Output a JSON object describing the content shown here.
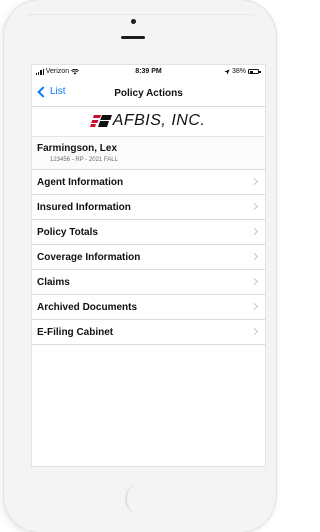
{
  "status_bar": {
    "carrier": "Verizon",
    "time": "8:39 PM",
    "battery": "38%",
    "battery_level": 0.38
  },
  "nav": {
    "back_label": "List",
    "title": "Policy Actions"
  },
  "logo": {
    "text": "AFBIS, INC."
  },
  "client": {
    "name": "Farmingson, Lex",
    "details": "123456 - RP - 2021 FALL"
  },
  "menu": {
    "items": [
      {
        "label": "Agent Information"
      },
      {
        "label": "Insured Information"
      },
      {
        "label": "Policy Totals"
      },
      {
        "label": "Coverage Information"
      },
      {
        "label": "Claims"
      },
      {
        "label": "Archived Documents"
      },
      {
        "label": "E-Filing Cabinet"
      }
    ]
  },
  "colors": {
    "accent": "#0a7aff",
    "logo_red": "#c8102e"
  }
}
